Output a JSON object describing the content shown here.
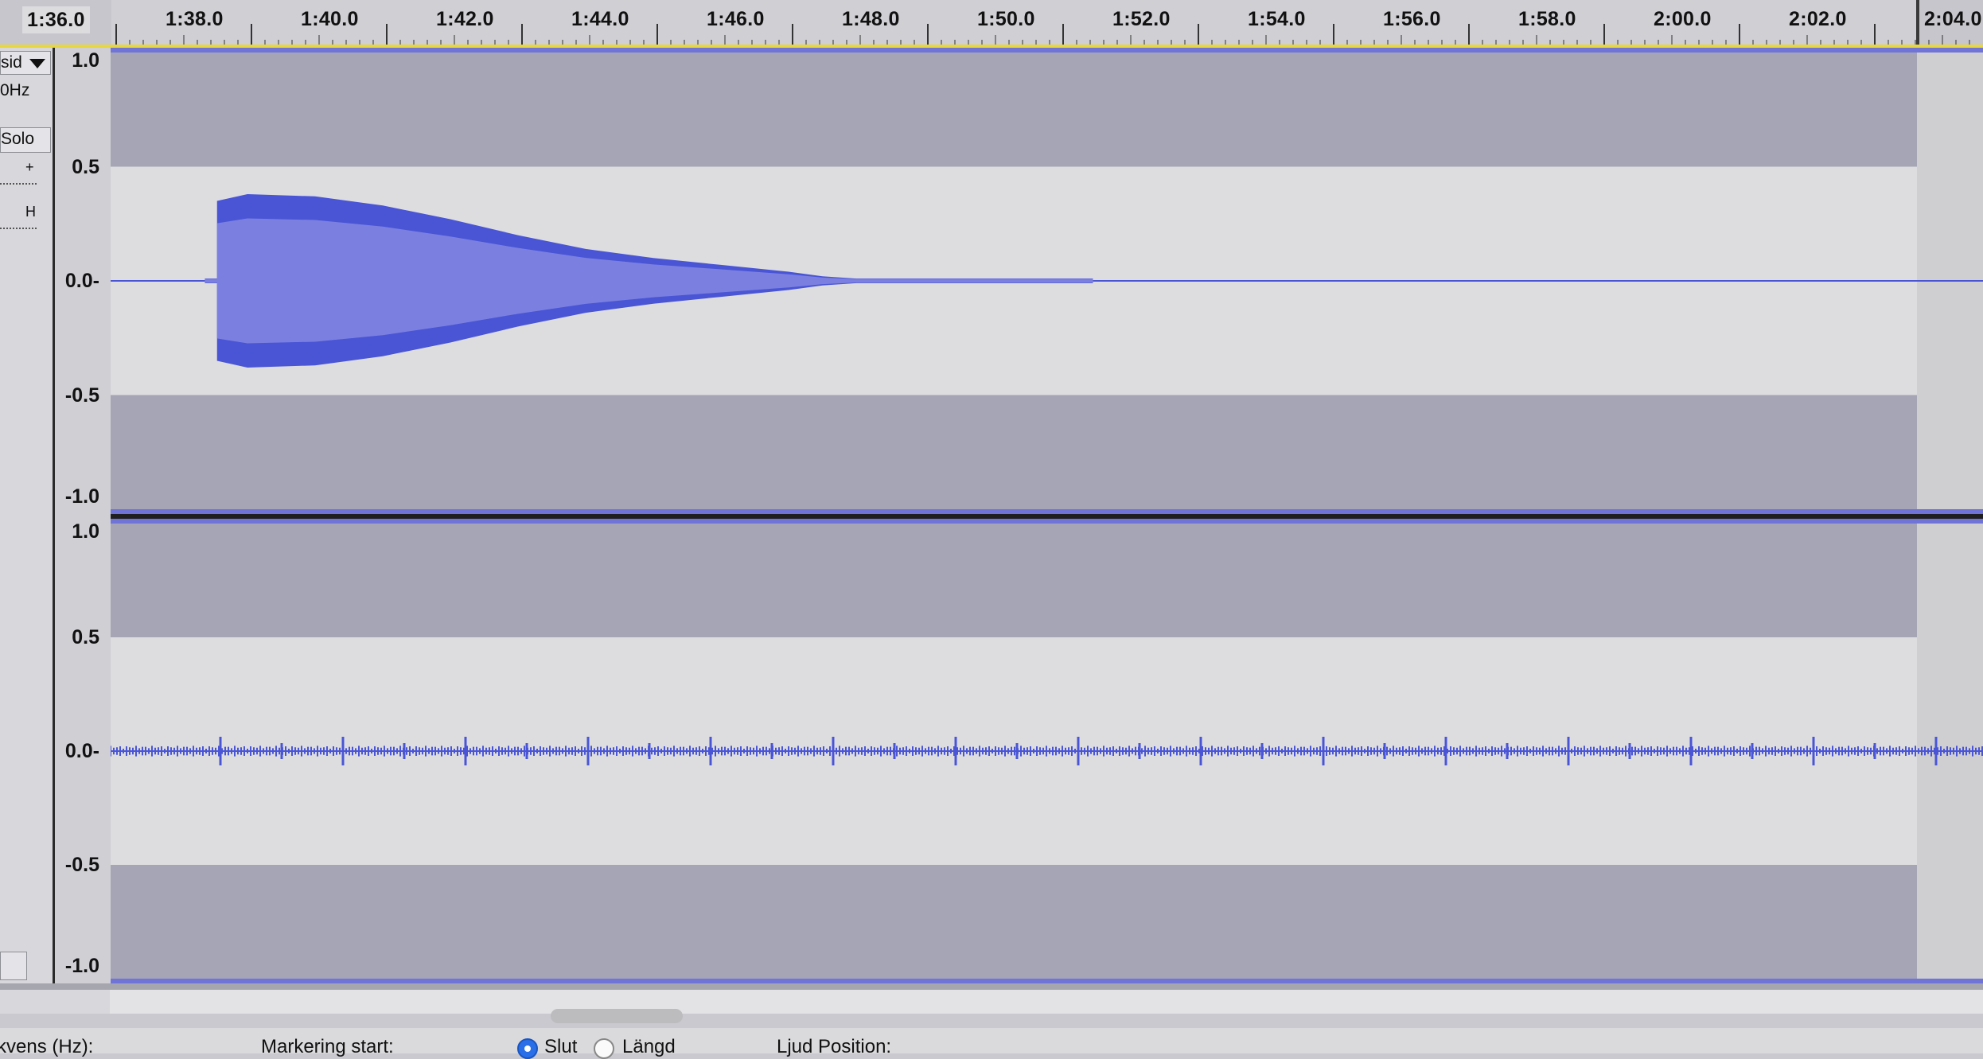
{
  "ruler": {
    "labels": [
      "1:36.0",
      "1:38.0",
      "1:40.0",
      "1:42.0",
      "1:44.0",
      "1:46.0",
      "1:48.0",
      "1:50.0",
      "1:52.0",
      "1:54.0",
      "1:56.0",
      "1:58.0",
      "2:00.0",
      "2:02.0",
      "2:04.0"
    ],
    "current_position": "1:36.0",
    "end_label": "2:04.0"
  },
  "track": {
    "name": "sid",
    "rate": "0Hz",
    "solo_label": "Solo",
    "gain_plus": "+",
    "pan_mark": "H"
  },
  "scale": {
    "labels": [
      "1.0",
      "0.5",
      "0.0-",
      "-0.5",
      "-1.0"
    ]
  },
  "waveform": {
    "color": "#4a55d6",
    "rms_color": "#7b80e0",
    "clip_background": "#dddde0",
    "outside_background": "#a5a5b5",
    "left_channel": {
      "envelope": [
        [
          1.37,
          0.01
        ],
        [
          1.55,
          0.01
        ],
        [
          1.55,
          0.35
        ],
        [
          2.0,
          0.38
        ],
        [
          3.0,
          0.37
        ],
        [
          4.0,
          0.33
        ],
        [
          5.0,
          0.27
        ],
        [
          6.0,
          0.2
        ],
        [
          7.0,
          0.14
        ],
        [
          8.0,
          0.1
        ],
        [
          9.0,
          0.07
        ],
        [
          10.0,
          0.04
        ],
        [
          10.5,
          0.02
        ],
        [
          11.0,
          0.01
        ],
        [
          14.5,
          0.01
        ]
      ],
      "note": "Amplitude values are seconds after 1:36.0 and peak level"
    },
    "right_channel": {
      "level": 0.01
    }
  },
  "status": {
    "rate_label": "kvens (Hz):",
    "selection_start_label": "Markering start:",
    "end_option": "Slut",
    "length_option": "Längd",
    "audio_position_label": "Ljud Position:"
  }
}
